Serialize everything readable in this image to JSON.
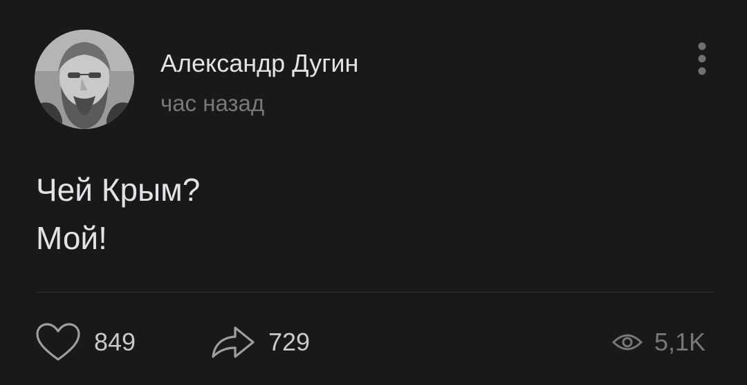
{
  "post": {
    "author": {
      "name": "Александр Дугин",
      "avatar_icon": "avatar-photo"
    },
    "time": "час назад",
    "text_lines": [
      "Чей Крым?",
      "Мой!"
    ],
    "menu_icon": "more-vertical-icon"
  },
  "actions": {
    "likes": {
      "icon": "heart-icon",
      "count": "849"
    },
    "shares": {
      "icon": "share-arrow-icon",
      "count": "729"
    },
    "views": {
      "icon": "eye-icon",
      "count": "5,1K"
    }
  },
  "colors": {
    "background": "#19191a",
    "primary_text": "#e1e3e6",
    "secondary_text": "#76787a",
    "divider": "#2f2f31"
  }
}
